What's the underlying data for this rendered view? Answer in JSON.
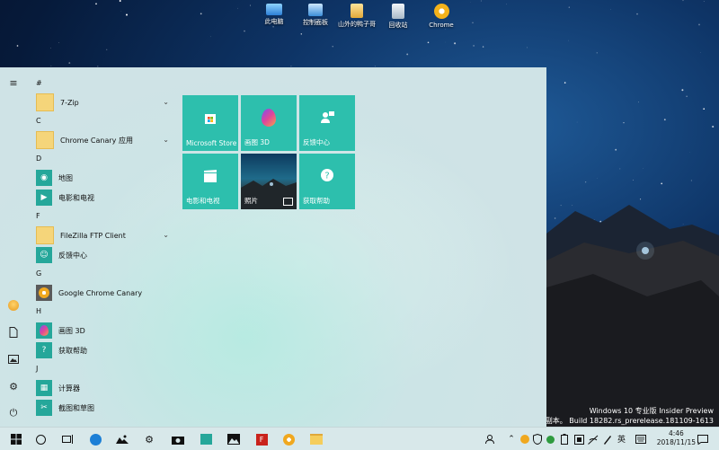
{
  "desktop": {
    "icons": [
      {
        "label": "此电脑",
        "icon": "computer-icon"
      },
      {
        "label": "控制面板",
        "icon": "control-panel-icon"
      },
      {
        "label": "山外的鸭子哥",
        "icon": "user-folder-icon"
      },
      {
        "label": "回收站",
        "icon": "recycle-bin-icon"
      },
      {
        "label": "Chrome",
        "icon": "chrome-icon"
      }
    ],
    "build_line1": "Windows 10 专业版 Insider Preview",
    "build_line2": "评估副本。 Build 18282.rs_prerelease.181109-1613"
  },
  "start_menu": {
    "sections": [
      {
        "letter": "#",
        "apps": [
          {
            "label": "7-Zip",
            "icon": "folder-icon",
            "expandable": true
          }
        ]
      },
      {
        "letter": "C",
        "apps": [
          {
            "label": "Chrome Canary 应用",
            "icon": "folder-icon",
            "expandable": true
          }
        ]
      },
      {
        "letter": "D",
        "apps": [
          {
            "label": "地图",
            "icon": "maps-icon",
            "expandable": false
          },
          {
            "label": "电影和电视",
            "icon": "movies-icon",
            "expandable": false
          }
        ]
      },
      {
        "letter": "F",
        "apps": [
          {
            "label": "FileZilla FTP Client",
            "icon": "folder-icon",
            "expandable": true
          },
          {
            "label": "反馈中心",
            "icon": "feedback-icon",
            "expandable": false
          }
        ]
      },
      {
        "letter": "G",
        "apps": [
          {
            "label": "Google Chrome Canary",
            "icon": "chrome-canary-icon",
            "expandable": false
          }
        ]
      },
      {
        "letter": "H",
        "apps": [
          {
            "label": "画图 3D",
            "icon": "paint3d-icon",
            "expandable": false
          },
          {
            "label": "获取帮助",
            "icon": "help-icon",
            "expandable": false
          }
        ]
      },
      {
        "letter": "J",
        "apps": [
          {
            "label": "计算器",
            "icon": "calculator-icon",
            "expandable": false
          },
          {
            "label": "截图和草图",
            "icon": "snip-icon",
            "expandable": false
          }
        ]
      }
    ],
    "tiles": [
      {
        "label": "Microsoft Store",
        "icon": "store-icon"
      },
      {
        "label": "画图 3D",
        "icon": "paint3d-icon"
      },
      {
        "label": "反馈中心",
        "icon": "feedback-icon"
      },
      {
        "label": "电影和电视",
        "icon": "movies-icon"
      },
      {
        "label": "照片",
        "icon": "photos-icon"
      },
      {
        "label": "获取帮助",
        "icon": "help-icon"
      }
    ]
  },
  "taskbar": {
    "language": "英",
    "time": "4:46",
    "date": "2018/11/15"
  },
  "colors": {
    "tile": "#2dbfad",
    "taskbar": "#d8e8ea",
    "start_menu": "#cfe3e6"
  }
}
